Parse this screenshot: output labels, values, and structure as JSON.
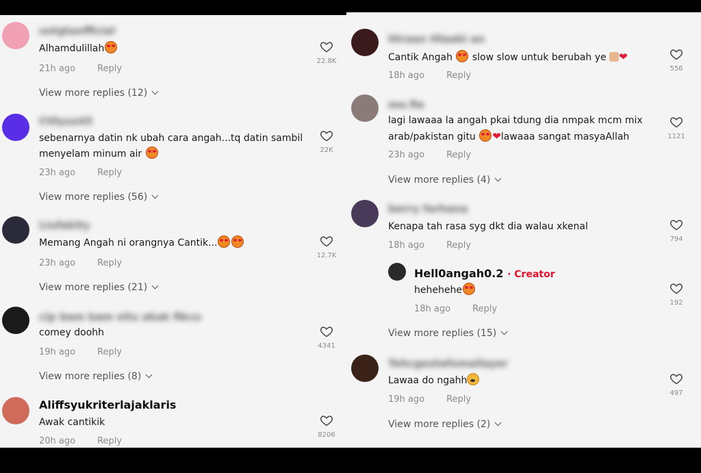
{
  "left": {
    "comments": [
      {
        "username": "ustgtaofficial",
        "text": "Alhamdulillah",
        "emojis": [
          "heart-eyes-face-icon"
        ],
        "time": "21h ago",
        "reply": "Reply",
        "likes": "22.8K",
        "more": "View more replies (12)",
        "avatar_color": "#f2a0b4"
      },
      {
        "username": "Ct0yuz45",
        "text": "sebenarnya datin nk ubah cara angah...tq datin sambil menyelam minum air",
        "emojis": [
          "heart-eyes-face-icon"
        ],
        "time": "23h ago",
        "reply": "Reply",
        "likes": "22K",
        "more": "View more replies (56)",
        "avatar_color": "#5a2ee6"
      },
      {
        "username": "Liufakity",
        "text": "Memang Angah ni orangnya Cantik...",
        "emojis": [
          "heart-eyes-face-icon",
          "heart-eyes-face-icon"
        ],
        "time": "23h ago",
        "reply": "Reply",
        "likes": "12.7K",
        "more": "View more replies (21)",
        "avatar_color": "#2a2a3a"
      },
      {
        "username": "cip bam bam situ akak fikcu",
        "text": "comey doohh",
        "emojis": [],
        "time": "19h ago",
        "reply": "Reply",
        "likes": "4341",
        "more": "View more replies (8)",
        "avatar_color": "#1a1a1a"
      },
      {
        "username": "Aliffsyukriterlajaklaris",
        "text": "Awak cantikik",
        "emojis": [],
        "time": "20h ago",
        "reply": "Reply",
        "likes": "8206",
        "more": "",
        "avatar_color": "#d06a5a"
      }
    ]
  },
  "right": {
    "comments": [
      {
        "username": "Hiraan Hlaabi an",
        "text": "Cantik Angah",
        "text_after": "slow slow untuk berubah ye",
        "emojis": [
          "heart-eyes-face-icon"
        ],
        "emojis_after": [
          "thumbs-up-icon",
          "red-heart-icon"
        ],
        "time": "18h ago",
        "reply": "Reply",
        "likes": "556",
        "more": "",
        "avatar_color": "#3a1a1a"
      },
      {
        "username": "me.fie",
        "text": "lagi lawaaa la angah pkai tdung dia nmpak mcm mix arab/pakistan gitu",
        "text_after": "lawaaa sangat masyaAllah",
        "emojis": [
          "heart-eyes-face-icon",
          "red-heart-icon"
        ],
        "time": "23h ago",
        "reply": "Reply",
        "likes": "1121",
        "more": "View more replies (4)",
        "avatar_color": "#8a7a78"
      },
      {
        "username": "berry farhana",
        "text": "Kenapa tah rasa syg dkt dia walau xkenal",
        "time": "18h ago",
        "reply": "Reply",
        "likes": "794",
        "more": "",
        "avatar_color": "#4a3a5a"
      },
      {
        "username": "Tehcgestafomallayer",
        "text": "Lawaa do ngahh",
        "emojis": [
          "crying-face-icon"
        ],
        "time": "19h ago",
        "reply": "Reply",
        "likes": "497",
        "more": "View more replies (2)",
        "avatar_color": "#3a2218"
      }
    ],
    "reply": {
      "username": "Hell0angah0.2",
      "creator": "· Creator",
      "text": "hehehehe",
      "emojis": [
        "heart-eyes-face-icon"
      ],
      "time": "18h ago",
      "reply": "Reply",
      "likes": "192",
      "more": "View more replies (15)",
      "avatar_color": "#2a2a2a"
    }
  }
}
